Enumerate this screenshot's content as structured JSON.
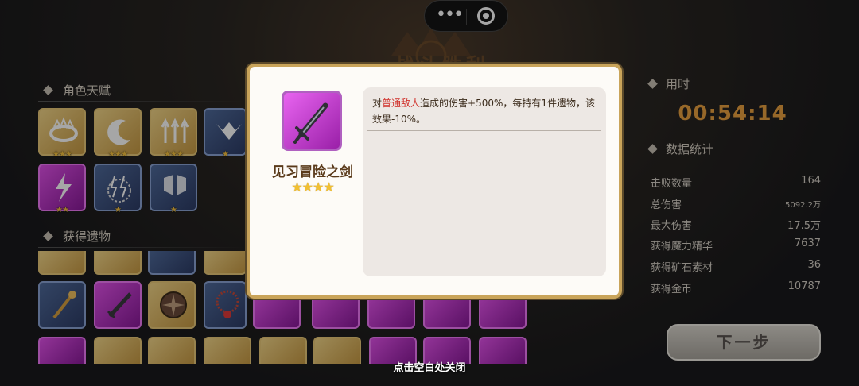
{
  "capsule": {
    "more_icon": "more-dots-icon",
    "close_icon": "target-close-icon"
  },
  "banner": {
    "title": "战斗胜利"
  },
  "left": {
    "talents_header": "角色天赋",
    "relics_header": "获得遗物"
  },
  "talents": [
    {
      "name": "talent-1",
      "color": "gold",
      "icon": "crown-ring-icon",
      "stars": "★★★"
    },
    {
      "name": "talent-2",
      "color": "gold",
      "icon": "crescent-moon-icon",
      "stars": "★★★"
    },
    {
      "name": "talent-3",
      "color": "gold",
      "icon": "lightning-arrows-icon",
      "stars": "★★★"
    },
    {
      "name": "talent-4",
      "color": "blue",
      "icon": "wing-skull-icon",
      "stars": "★"
    },
    {
      "name": "talent-5",
      "color": "purple",
      "icon": "lightning-figure-icon",
      "stars": "★★"
    },
    {
      "name": "talent-6",
      "color": "blue",
      "icon": "lightning-ring-icon",
      "stars": "★"
    },
    {
      "name": "talent-7",
      "color": "blue",
      "icon": "shield-pair-icon",
      "stars": "★"
    }
  ],
  "right": {
    "time_header": "用时",
    "time_value": "00:54:14",
    "stats_header": "数据统计",
    "stats": [
      {
        "label": "击败数量",
        "value": "164"
      },
      {
        "label": "总伤害",
        "value": "5092.2万"
      },
      {
        "label": "最大伤害",
        "value": "17.5万"
      },
      {
        "label": "获得魔力精华",
        "value": "7637"
      },
      {
        "label": "获得矿石素材",
        "value": "36"
      },
      {
        "label": "获得金币",
        "value": "10787"
      }
    ],
    "next_button": "下一步"
  },
  "modal": {
    "item_name": "见习冒险之剑",
    "item_icon": "sword-icon",
    "item_stars": "★★★★",
    "desc_prefix": "对",
    "desc_highlight": "普通敌人",
    "desc_suffix": "造成的伤害+500%，每持有1件遗物，该效果-10%。"
  },
  "close_hint": "点击空白处关闭",
  "colors": {
    "accent_gold": "#e8a040",
    "highlight_red": "#d0302a",
    "relic_purple": "#e050e8"
  }
}
